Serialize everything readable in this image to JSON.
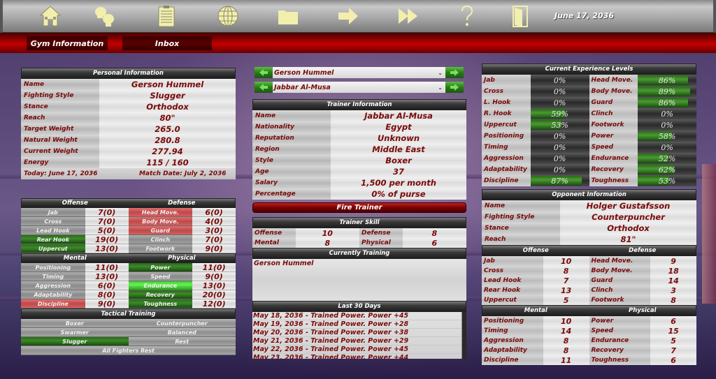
{
  "toolbar": {
    "icons": [
      "home-icon",
      "boxing-gloves-icon",
      "clipboard-icon",
      "globe-icon",
      "folder-icon",
      "arrow-right-icon",
      "fast-forward-icon",
      "help-icon",
      "exit-door-icon"
    ],
    "date": "June 17, 2036"
  },
  "tabs": [
    {
      "label": "Gym Information"
    },
    {
      "label": "Inbox"
    }
  ],
  "personal": {
    "title": "Personal Information",
    "rows": [
      {
        "label": "Name",
        "value": "Gerson Hummel"
      },
      {
        "label": "Fighting Style",
        "value": "Slugger"
      },
      {
        "label": "Stance",
        "value": "Orthodox"
      },
      {
        "label": "Reach",
        "value": "80\""
      },
      {
        "label": "Target Weight",
        "value": "265.0"
      },
      {
        "label": "Natural Weight",
        "value": "280.8"
      },
      {
        "label": "Current Weight",
        "value": "277.94"
      },
      {
        "label": "Energy",
        "value": "115 / 160"
      }
    ],
    "today": "Today: June 17, 2036",
    "match_date": "Match Date: July 2, 2036"
  },
  "skills": {
    "offense_title": "Offense",
    "defense_title": "Defense",
    "mental_title": "Mental",
    "physical_title": "Physical",
    "offense_defense": [
      {
        "l1": "Jab",
        "v1": "7(0)",
        "l2": "Head Move.",
        "v2": "6(0)"
      },
      {
        "l1": "Cross",
        "v1": "7(0)",
        "l2": "Body Move.",
        "v2": "4(0)"
      },
      {
        "l1": "Lead Hook",
        "v1": "5(0)",
        "l2": "Guard",
        "v2": "3(0)"
      },
      {
        "l1": "Rear Hook",
        "v1": "19(0)",
        "l2": "Clinch",
        "v2": "7(0)"
      },
      {
        "l1": "Uppercut",
        "v1": "13(0)",
        "l2": "Footwork",
        "v2": "9(0)"
      }
    ],
    "mental_physical": [
      {
        "l1": "Positioning",
        "v1": "11(0)",
        "l2": "Power",
        "v2": "11(0)"
      },
      {
        "l1": "Timing",
        "v1": "13(0)",
        "l2": "Speed",
        "v2": "9(0)"
      },
      {
        "l1": "Aggression",
        "v1": "6(0)",
        "l2": "Endurance",
        "v2": "13(0)"
      },
      {
        "l1": "Adaptability",
        "v1": "8(0)",
        "l2": "Recovery",
        "v2": "20(0)"
      },
      {
        "l1": "Discipline",
        "v1": "9(0)",
        "l2": "Toughness",
        "v2": "12(0)"
      }
    ]
  },
  "tactical": {
    "title": "Tactical Training",
    "options": [
      "Boxer",
      "Counterpuncher",
      "Swarmer",
      "Balanced",
      "Slugger",
      "Rest"
    ],
    "selected": "Slugger",
    "all_rest": "All Fighters Rest"
  },
  "selectors": {
    "fighter": "Gerson Hummel",
    "trainer": "Jabbar Al-Musa"
  },
  "trainer": {
    "title": "Trainer Information",
    "rows": [
      {
        "label": "Name",
        "value": "Jabbar Al-Musa"
      },
      {
        "label": "Nationality",
        "value": "Egypt"
      },
      {
        "label": "Reputation",
        "value": "Unknown"
      },
      {
        "label": "Region",
        "value": "Middle East"
      },
      {
        "label": "Style",
        "value": "Boxer"
      },
      {
        "label": "Age",
        "value": "37"
      },
      {
        "label": "Salary",
        "value": "1,500 per month"
      },
      {
        "label": "Percentage",
        "value": "0% of purse"
      }
    ],
    "fire_label": "Fire Trainer",
    "skill_title": "Trainer Skill",
    "skills": [
      {
        "l1": "Offense",
        "v1": "10",
        "l2": "Defense",
        "v2": "8"
      },
      {
        "l1": "Mental",
        "v1": "8",
        "l2": "Physical",
        "v2": "6"
      }
    ],
    "training_title": "Currently Training",
    "training": [
      "Gerson Hummel"
    ],
    "log_title": "Last 30 Days",
    "log": [
      "May 18, 2036 - Trained Power. Power +45",
      "May 19, 2036 - Trained Power. Power +28",
      "May 20, 2036 - Trained Power. Power +38",
      "May 21, 2036 - Trained Power. Power +29",
      "May 22, 2036 - Trained Power. Power +45",
      "May 23, 2036 - Trained Power. Power +44"
    ]
  },
  "experience": {
    "title": "Current Experience Levels",
    "rows": [
      {
        "l1": "Jab",
        "p1": 0,
        "l2": "Head Move.",
        "p2": 86
      },
      {
        "l1": "Cross",
        "p1": 0,
        "l2": "Body Move.",
        "p2": 89
      },
      {
        "l1": "L. Hook",
        "p1": 0,
        "l2": "Guard",
        "p2": 86
      },
      {
        "l1": "R. Hook",
        "p1": 59,
        "l2": "Clinch",
        "p2": 0
      },
      {
        "l1": "Uppercut",
        "p1": 53,
        "l2": "Footwork",
        "p2": 0
      },
      {
        "l1": "Positioning",
        "p1": 0,
        "l2": "Power",
        "p2": 58
      },
      {
        "l1": "Timing",
        "p1": 0,
        "l2": "Speed",
        "p2": 0
      },
      {
        "l1": "Aggression",
        "p1": 0,
        "l2": "Endurance",
        "p2": 52
      },
      {
        "l1": "Adaptability",
        "p1": 0,
        "l2": "Recovery",
        "p2": 62
      },
      {
        "l1": "Discipline",
        "p1": 87,
        "l2": "Toughness",
        "p2": 53
      }
    ]
  },
  "opponent": {
    "title": "Opponent Information",
    "rows": [
      {
        "label": "Name",
        "value": "Holger Gustafsson"
      },
      {
        "label": "Fighting Style",
        "value": "Counterpuncher"
      },
      {
        "label": "Stance",
        "value": "Orthodox"
      },
      {
        "label": "Reach",
        "value": "81\""
      }
    ],
    "offense_defense": [
      {
        "l1": "Jab",
        "v1": "10",
        "l2": "Head Move.",
        "v2": "9"
      },
      {
        "l1": "Cross",
        "v1": "8",
        "l2": "Body Move.",
        "v2": "18"
      },
      {
        "l1": "Lead Hook",
        "v1": "7",
        "l2": "Guard",
        "v2": "14"
      },
      {
        "l1": "Rear Hook",
        "v1": "13",
        "l2": "Clinch",
        "v2": "3"
      },
      {
        "l1": "Uppercut",
        "v1": "5",
        "l2": "Footwork",
        "v2": "8"
      }
    ],
    "mental_physical": [
      {
        "l1": "Positioning",
        "v1": "10",
        "l2": "Power",
        "v2": "6"
      },
      {
        "l1": "Timing",
        "v1": "14",
        "l2": "Speed",
        "v2": "15"
      },
      {
        "l1": "Aggression",
        "v1": "8",
        "l2": "Endurance",
        "v2": "5"
      },
      {
        "l1": "Adaptability",
        "v1": "8",
        "l2": "Recovery",
        "v2": "7"
      },
      {
        "l1": "Discipline",
        "v1": "11",
        "l2": "Toughness",
        "v2": "6"
      }
    ]
  }
}
